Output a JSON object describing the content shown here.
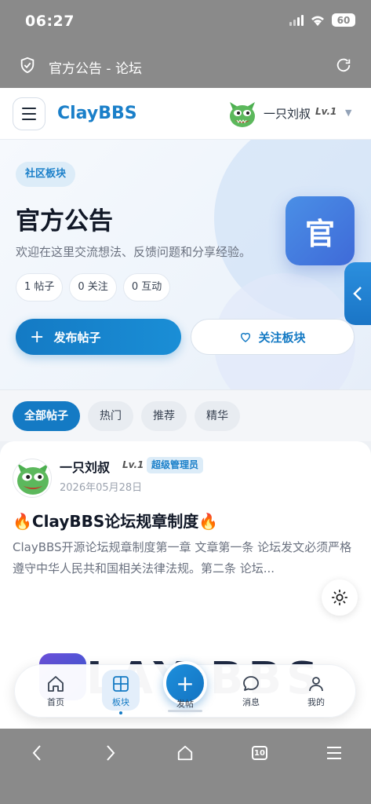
{
  "status": {
    "time": "06:27",
    "battery": "60"
  },
  "browser": {
    "page_title": "官方公告 - 论坛",
    "tab_count": "10"
  },
  "header": {
    "brand": "ClayBBS",
    "user_name": "一只刘叔",
    "user_level": "Lv.1"
  },
  "hero": {
    "badge": "社区板块",
    "title": "官方公告",
    "description": "欢迎在这里交流想法、反馈问题和分享经验。",
    "icon_char": "官",
    "stats": [
      "1 帖子",
      "0 关注",
      "0 互动"
    ],
    "post_button": "发布帖子",
    "follow_button": "关注板块"
  },
  "tabs": [
    {
      "label": "全部帖子",
      "active": true
    },
    {
      "label": "热门",
      "active": false
    },
    {
      "label": "推荐",
      "active": false
    },
    {
      "label": "精华",
      "active": false
    }
  ],
  "post": {
    "author": "一只刘叔",
    "level": "Lv.1",
    "role": "超级管理员",
    "date": "2026年05月28日",
    "title": "🔥ClayBBS论坛规章制度🔥",
    "excerpt": "ClayBBS开源论坛规章制度第一章 文章第一条 论坛发文必须严格遵守中华人民共和国相关法律法规。第二条 论坛...",
    "image_text": "LAY BBS"
  },
  "bottom_nav": {
    "home": "首页",
    "boards": "板块",
    "post": "发帖",
    "messages": "消息",
    "me": "我的"
  },
  "colors": {
    "accent": "#147ac4",
    "badge_bg": "#dcecf8",
    "browser_chrome": "#8a8a8a"
  }
}
